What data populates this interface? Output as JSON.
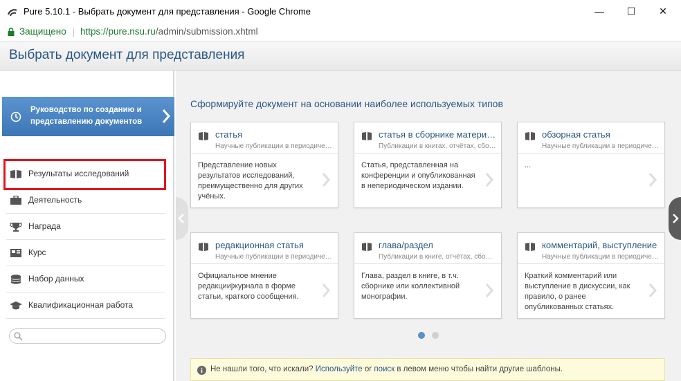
{
  "window": {
    "title": "Pure 5.10.1 - Выбрать документ для представления - Google Chrome",
    "minimize": "—",
    "maximize": "☐",
    "close": "✕"
  },
  "address_bar": {
    "secure_label": "Защищено",
    "url_host": "https://pure.nsu.ru",
    "url_path": "/admin/submission.xhtml"
  },
  "page": {
    "title": "Выбрать документ для представления"
  },
  "sidebar": {
    "guide_label": "Руководство по созданию и представлению документов",
    "items": [
      {
        "label": "Результаты исследований",
        "icon": "book-icon"
      },
      {
        "label": "Деятельность",
        "icon": "briefcase-icon"
      },
      {
        "label": "Награда",
        "icon": "trophy-icon"
      },
      {
        "label": "Курс",
        "icon": "course-icon"
      },
      {
        "label": "Набор данных",
        "icon": "database-icon"
      },
      {
        "label": "Квалификационная работа",
        "icon": "graduation-cap-icon"
      }
    ],
    "search_placeholder": ""
  },
  "main": {
    "heading": "Сформируйте документ на основании наиболее используемых типов",
    "cards": [
      {
        "title": "статья",
        "subtitle": "Научные публикации в периодических изданиях",
        "description": "Представление новых результатов исследований, преимущественно для других учёных."
      },
      {
        "title": "статья в сборнике материалов конференции",
        "subtitle": "Публикации в книгах, отчётах, сборниках",
        "description": "Статья, представленная на конференции и опубликованная в непериодическом издании."
      },
      {
        "title": "обзорная статья",
        "subtitle": "Научные публикации в периодических изданиях",
        "description": "..."
      },
      {
        "title": "редакционная статья",
        "subtitle": "Научные публикации в периодических изданиях",
        "description": "Официальное мнение редакцииjжурнала в форме статьи, краткого сообщения."
      },
      {
        "title": "глава/раздел",
        "subtitle": "Публикации в книге, отчётах, сборниках",
        "description": "Глава, раздел в книге, в т.ч. сборнике или коллективной монографии."
      },
      {
        "title": "комментарий, выступление",
        "subtitle": "Научные публикации в периодических изданиях",
        "description": "Краткий комментарий или выступление в дискуссии, как правило, о ранее опубликованных статьях."
      }
    ],
    "notice": {
      "before": "Не нашли того, что искали? ",
      "link1": "Используйте",
      "middle": " or ",
      "link2": "поиск",
      "after": " в левом меню чтобы найти другие шаблоны."
    }
  },
  "colors": {
    "accent": "#2a5685",
    "guide_bg": "#4a86c5",
    "highlight": "#e0151f",
    "secure": "#1b7a2a"
  }
}
